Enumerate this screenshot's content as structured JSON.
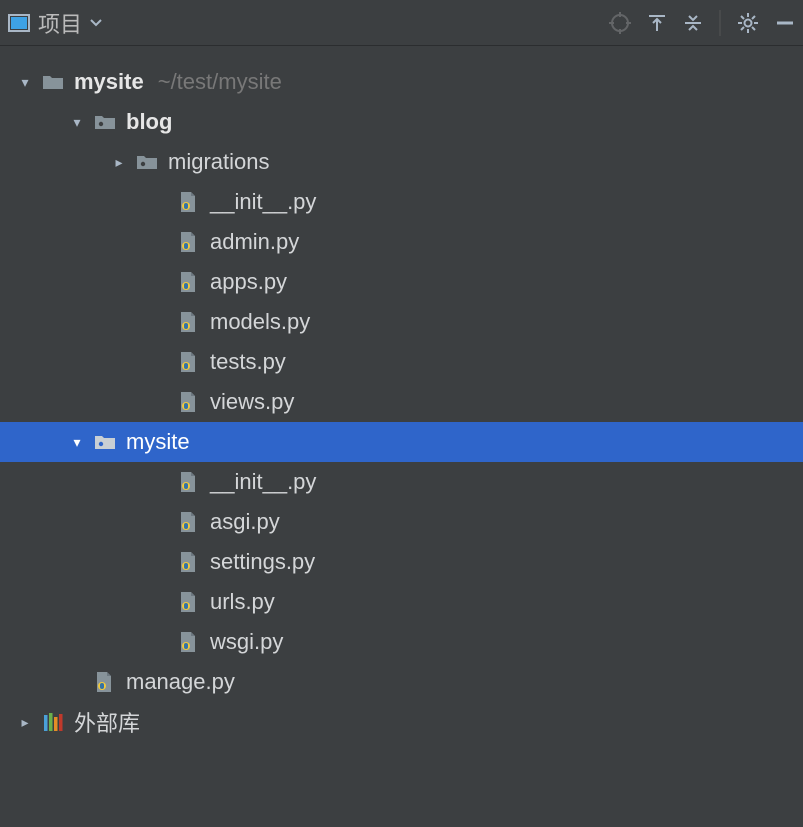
{
  "toolbar": {
    "title": "项目"
  },
  "tree": {
    "root": {
      "name": "mysite",
      "path": "~/test/mysite",
      "children": {
        "blog": {
          "name": "blog",
          "migrations": "migrations",
          "files": [
            "__init__.py",
            "admin.py",
            "apps.py",
            "models.py",
            "tests.py",
            "views.py"
          ]
        },
        "mysite": {
          "name": "mysite",
          "files": [
            "__init__.py",
            "asgi.py",
            "settings.py",
            "urls.py",
            "wsgi.py"
          ]
        },
        "manage": "manage.py"
      }
    },
    "external": "外部库"
  }
}
